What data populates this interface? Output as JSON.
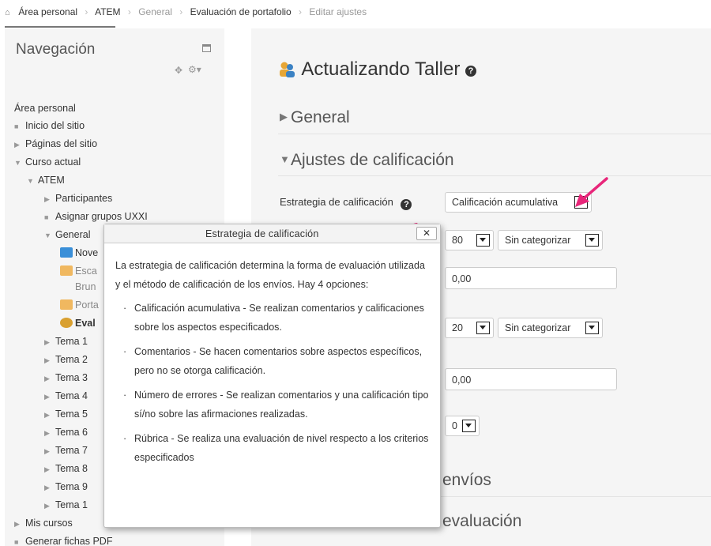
{
  "breadcrumb": {
    "items": [
      "Área personal",
      "ATEM",
      "General",
      "Evaluación de portafolio",
      "Editar ajustes"
    ]
  },
  "sidebar": {
    "title": "Navegación",
    "tree": [
      {
        "label": "Área personal"
      },
      {
        "label": "Inicio del sitio"
      },
      {
        "label": "Páginas del sitio"
      },
      {
        "label": "Curso actual"
      },
      {
        "label": "ATEM"
      },
      {
        "label": "Participantes"
      },
      {
        "label": "Asignar grupos UXXI"
      },
      {
        "label": "General"
      },
      {
        "label": "Nove"
      },
      {
        "label": "Esca"
      },
      {
        "label": "Brun"
      },
      {
        "label": "Porta"
      },
      {
        "label": "Eval"
      },
      {
        "label": "Tema 1"
      },
      {
        "label": "Tema 2"
      },
      {
        "label": "Tema 3"
      },
      {
        "label": "Tema 4"
      },
      {
        "label": "Tema 5"
      },
      {
        "label": "Tema 6"
      },
      {
        "label": "Tema 7"
      },
      {
        "label": "Tema 8"
      },
      {
        "label": "Tema 9"
      },
      {
        "label": "Tema 1"
      },
      {
        "label": "Mis cursos"
      },
      {
        "label": "Generar fichas PDF"
      }
    ]
  },
  "main": {
    "title": "Actualizando Taller",
    "sections": {
      "general": "General",
      "grading": "Ajustes de calificación",
      "envios": "envíos",
      "evaluacion": "evaluación"
    },
    "grading_strategy_label": "Estrategia de calificación",
    "grading_strategy_value": "Calificación acumulativa",
    "grade1": "80",
    "category1": "Sin categorizar",
    "pass1": "0,00",
    "grade2": "20",
    "category2": "Sin categorizar",
    "pass2": "0,00",
    "decimals": "0"
  },
  "popup": {
    "title": "Estrategia de calificación",
    "close": "✕",
    "intro": "La estrategia de calificación determina la forma de evaluación utilizada y el método de calificación de los envíos. Hay 4 opciones:",
    "options": [
      "Calificación acumulativa - Se realizan comentarios y calificaciones sobre los aspectos especificados.",
      "Comentarios - Se hacen comentarios sobre aspectos específicos, pero no se otorga calificación.",
      "Número de errores - Se realizan comentarios y una calificación tipo sí/no sobre las afirmaciones realizadas.",
      "Rúbrica - Se realiza una evaluación de nivel respecto a los criterios especificados"
    ]
  },
  "colors": {
    "accent_arrow": "#e8267a",
    "sidebar_bg": "#f5f5f5",
    "main_bg": "#f5f5f5"
  }
}
